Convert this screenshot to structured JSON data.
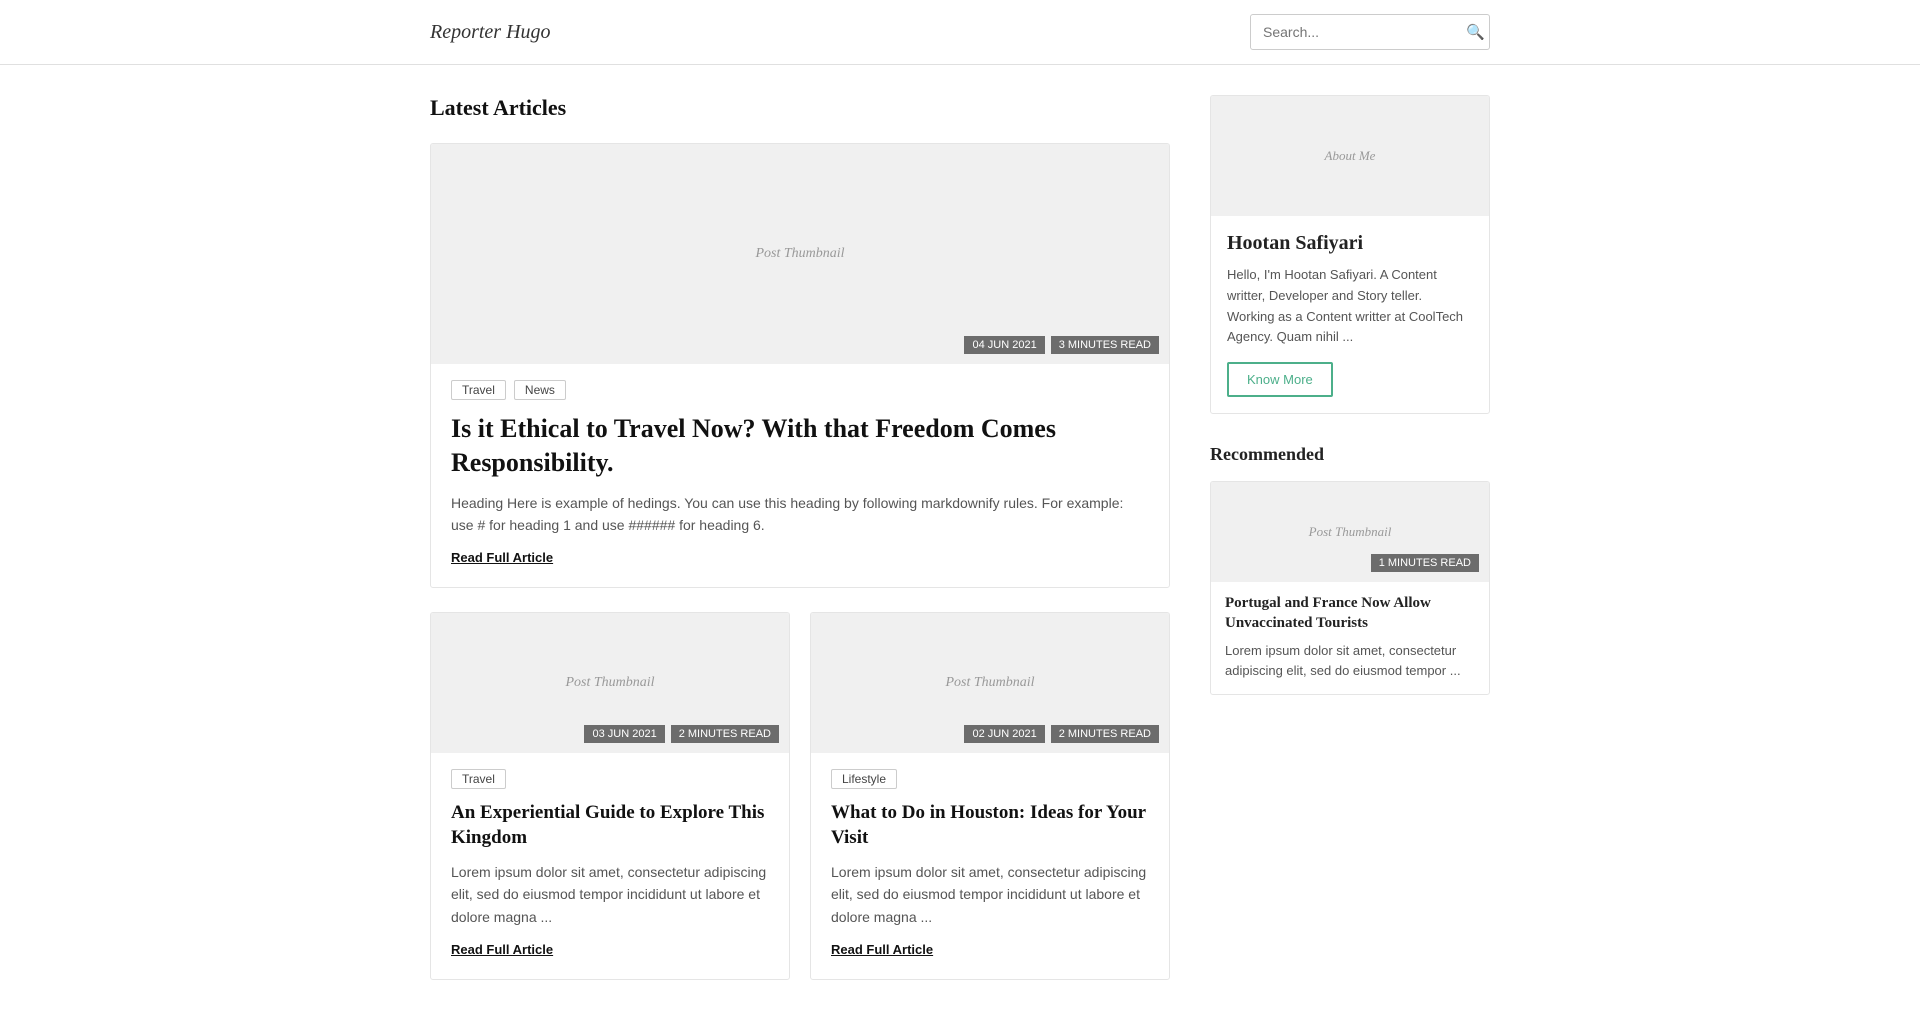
{
  "header": {
    "logo_text": "Reporter Hugo",
    "search_placeholder": "Search..."
  },
  "main": {
    "section_title": "Latest Articles",
    "featured_article": {
      "thumbnail_text": "Post Thumbnail",
      "date": "04 JUN 2021",
      "read_time": "3 MINUTES READ",
      "tags": [
        "Travel",
        "News"
      ],
      "title": "Is it Ethical to Travel Now? With that Freedom Comes Responsibility.",
      "excerpt": "Heading Here is example of hedings. You can use this heading by following markdownify rules. For example: use # for heading 1 and use ###### for heading 6.",
      "read_more": "Read Full Article"
    },
    "article_card_1": {
      "thumbnail_text": "Post Thumbnail",
      "date": "03 JUN 2021",
      "read_time": "2 MINUTES READ",
      "tags": [
        "Travel"
      ],
      "title": "An Experiential Guide to Explore This Kingdom",
      "excerpt": "Lorem ipsum dolor sit amet, consectetur adipiscing elit, sed do eiusmod tempor incididunt ut labore et dolore magna ...",
      "read_more": "Read Full Article"
    },
    "article_card_2": {
      "thumbnail_text": "Post Thumbnail",
      "date": "02 JUN 2021",
      "read_time": "2 MINUTES READ",
      "tags": [
        "Lifestyle"
      ],
      "title": "What to Do in Houston: Ideas for Your Visit",
      "excerpt": "Lorem ipsum dolor sit amet, consectetur adipiscing elit, sed do eiusmod tempor incididunt ut labore et dolore magna ...",
      "read_more": "Read Full Article"
    }
  },
  "sidebar": {
    "about": {
      "thumbnail_text": "About Me",
      "name": "Hootan Safiyari",
      "bio": "Hello, I'm Hootan Safiyari. A Content writter, Developer and Story teller. Working as a Content writter at CoolTech Agency. Quam nihil ...",
      "know_more_label": "Know More"
    },
    "recommended": {
      "title": "Recommended",
      "card": {
        "thumbnail_text": "Post Thumbnail",
        "read_time": "1 MINUTES READ",
        "title": "Portugal and France Now Allow Unvaccinated Tourists",
        "excerpt": "Lorem ipsum dolor sit amet, consectetur adipiscing elit, sed do eiusmod tempor ..."
      }
    }
  }
}
